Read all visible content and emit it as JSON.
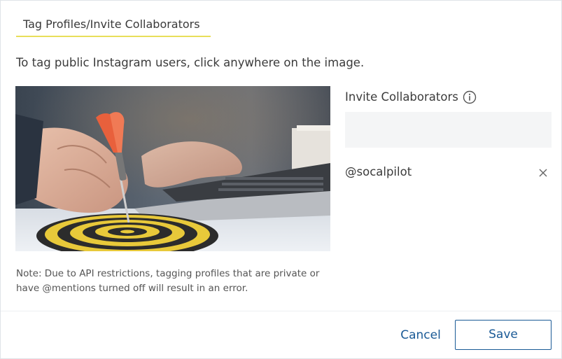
{
  "dialog": {
    "tab_label": "Tag Profiles/Invite Collaborators",
    "instruction": "To tag public Instagram users, click anywhere on the image.",
    "note": "Note: Due to API restrictions, tagging profiles that are private or have @mentions turned off will result in an error."
  },
  "collaborators": {
    "label": "Invite Collaborators",
    "info_icon": "info-circle-icon",
    "input_value": "",
    "input_placeholder": "",
    "items": [
      {
        "handle": "@socalpilot",
        "remove_icon": "close-icon"
      }
    ]
  },
  "actions": {
    "cancel_label": "Cancel",
    "save_label": "Save"
  },
  "colors": {
    "accent": "#1a5a96",
    "tab_underline": "#e8df5a",
    "input_bg": "#f4f5f6"
  }
}
